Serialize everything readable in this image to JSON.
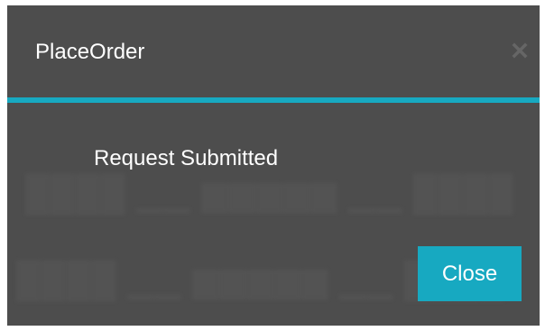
{
  "dialog": {
    "title": "PlaceOrder",
    "close_icon": "close-x-icon",
    "message": "Request Submitted",
    "close_button_label": "Close"
  },
  "colors": {
    "dialog_background": "#4d4d4d",
    "accent": "#17a9c1",
    "button_background": "#17a9c1",
    "close_icon": "#666666"
  }
}
